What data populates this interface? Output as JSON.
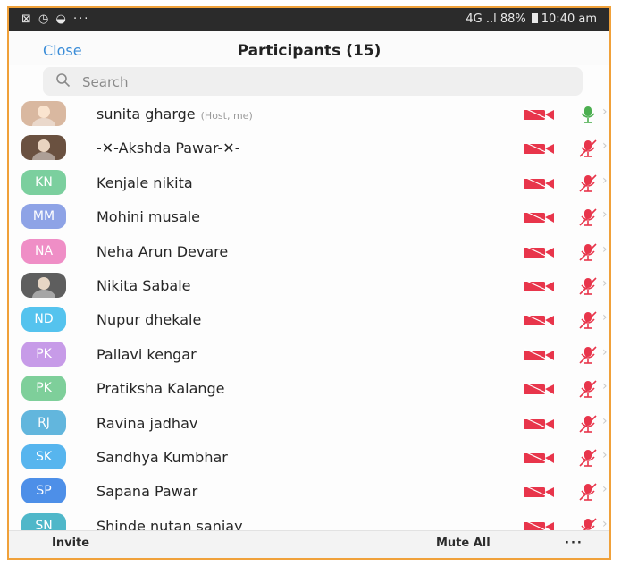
{
  "status_bar": {
    "left_icons": "⊠ ◷ ◒ ···",
    "signal": "4G ..l",
    "battery": "88%",
    "time": "10:40 am"
  },
  "header": {
    "close_label": "Close",
    "title": "Participants (15)"
  },
  "search": {
    "placeholder": "Search"
  },
  "participants": [
    {
      "initials": "",
      "name": "sunita gharge",
      "tag": "(Host, me)",
      "avatar_color": "#d9b8a0",
      "photo": true,
      "mic_muted": false
    },
    {
      "initials": "",
      "name": "-✕-Akshda Pawar-✕-",
      "tag": "",
      "avatar_color": "#6a5140",
      "photo": true,
      "mic_muted": true
    },
    {
      "initials": "KN",
      "name": "Kenjale nikita",
      "tag": "",
      "avatar_color": "#7bcf9e",
      "photo": false,
      "mic_muted": true
    },
    {
      "initials": "MM",
      "name": "Mohini musale",
      "tag": "",
      "avatar_color": "#8ea3e6",
      "photo": false,
      "mic_muted": true
    },
    {
      "initials": "NA",
      "name": "Neha Arun Devare",
      "tag": "",
      "avatar_color": "#ef8ec6",
      "photo": false,
      "mic_muted": true
    },
    {
      "initials": "",
      "name": "Nikita Sabale",
      "tag": "",
      "avatar_color": "#5e5e5e",
      "photo": true,
      "mic_muted": true
    },
    {
      "initials": "ND",
      "name": "Nupur dhekale",
      "tag": "",
      "avatar_color": "#55c3ee",
      "photo": false,
      "mic_muted": true
    },
    {
      "initials": "PK",
      "name": "Pallavi kengar",
      "tag": "",
      "avatar_color": "#c79be8",
      "photo": false,
      "mic_muted": true
    },
    {
      "initials": "PK",
      "name": "Pratiksha Kalange",
      "tag": "",
      "avatar_color": "#7ecf9a",
      "photo": false,
      "mic_muted": true
    },
    {
      "initials": "RJ",
      "name": "Ravina jadhav",
      "tag": "",
      "avatar_color": "#62b6dd",
      "photo": false,
      "mic_muted": true
    },
    {
      "initials": "SK",
      "name": "Sandhya Kumbhar",
      "tag": "",
      "avatar_color": "#57b5ee",
      "photo": false,
      "mic_muted": true
    },
    {
      "initials": "SP",
      "name": "Sapana Pawar",
      "tag": "",
      "avatar_color": "#4d8fe8",
      "photo": false,
      "mic_muted": true
    },
    {
      "initials": "SN",
      "name": "Shinde nutan sanjay",
      "tag": "",
      "avatar_color": "#4fb7c9",
      "photo": false,
      "mic_muted": true
    }
  ],
  "bottom_bar": {
    "invite_label": "Invite",
    "mute_all_label": "Mute All",
    "more_label": "···"
  },
  "colors": {
    "accent": "#3b8dd8",
    "muted_red": "#e8354b",
    "mic_on_green": "#4caf50",
    "frame_border": "#f0a13a"
  }
}
